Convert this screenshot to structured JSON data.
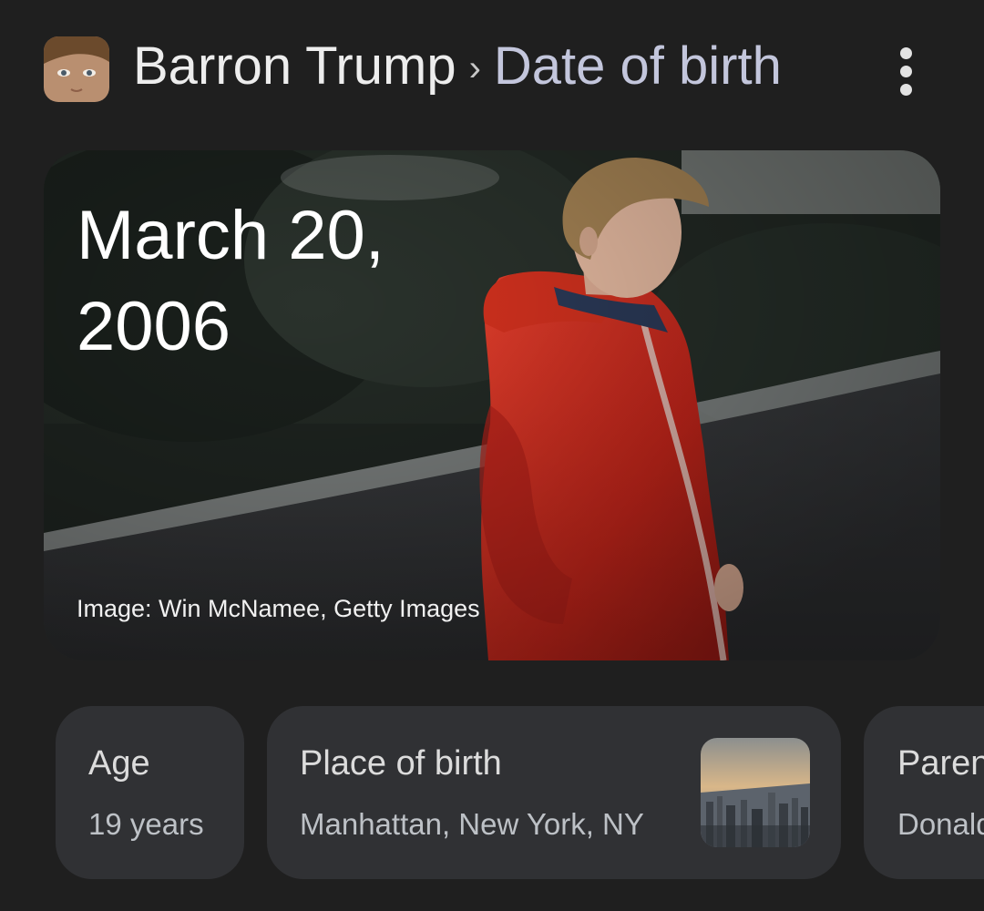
{
  "header": {
    "entity": "Barron Trump",
    "separator": "›",
    "attribute": "Date of birth",
    "avatar_icon": "person-avatar-thumbnail",
    "more_icon": "more-vert-icon"
  },
  "hero": {
    "date": "March 20, 2006",
    "credit": "Image: Win McNamee, Getty Images"
  },
  "chips": [
    {
      "label": "Age",
      "value": "19 years"
    },
    {
      "label": "Place of birth",
      "value": "Manhattan, New York, NY",
      "thumb_icon": "city-skyline-thumbnail"
    },
    {
      "label": "Parents",
      "value": "Donald Trump"
    }
  ],
  "colors": {
    "background": "#1f1f1f",
    "chip": "#303134",
    "attribute_text": "#c3c6dc"
  }
}
